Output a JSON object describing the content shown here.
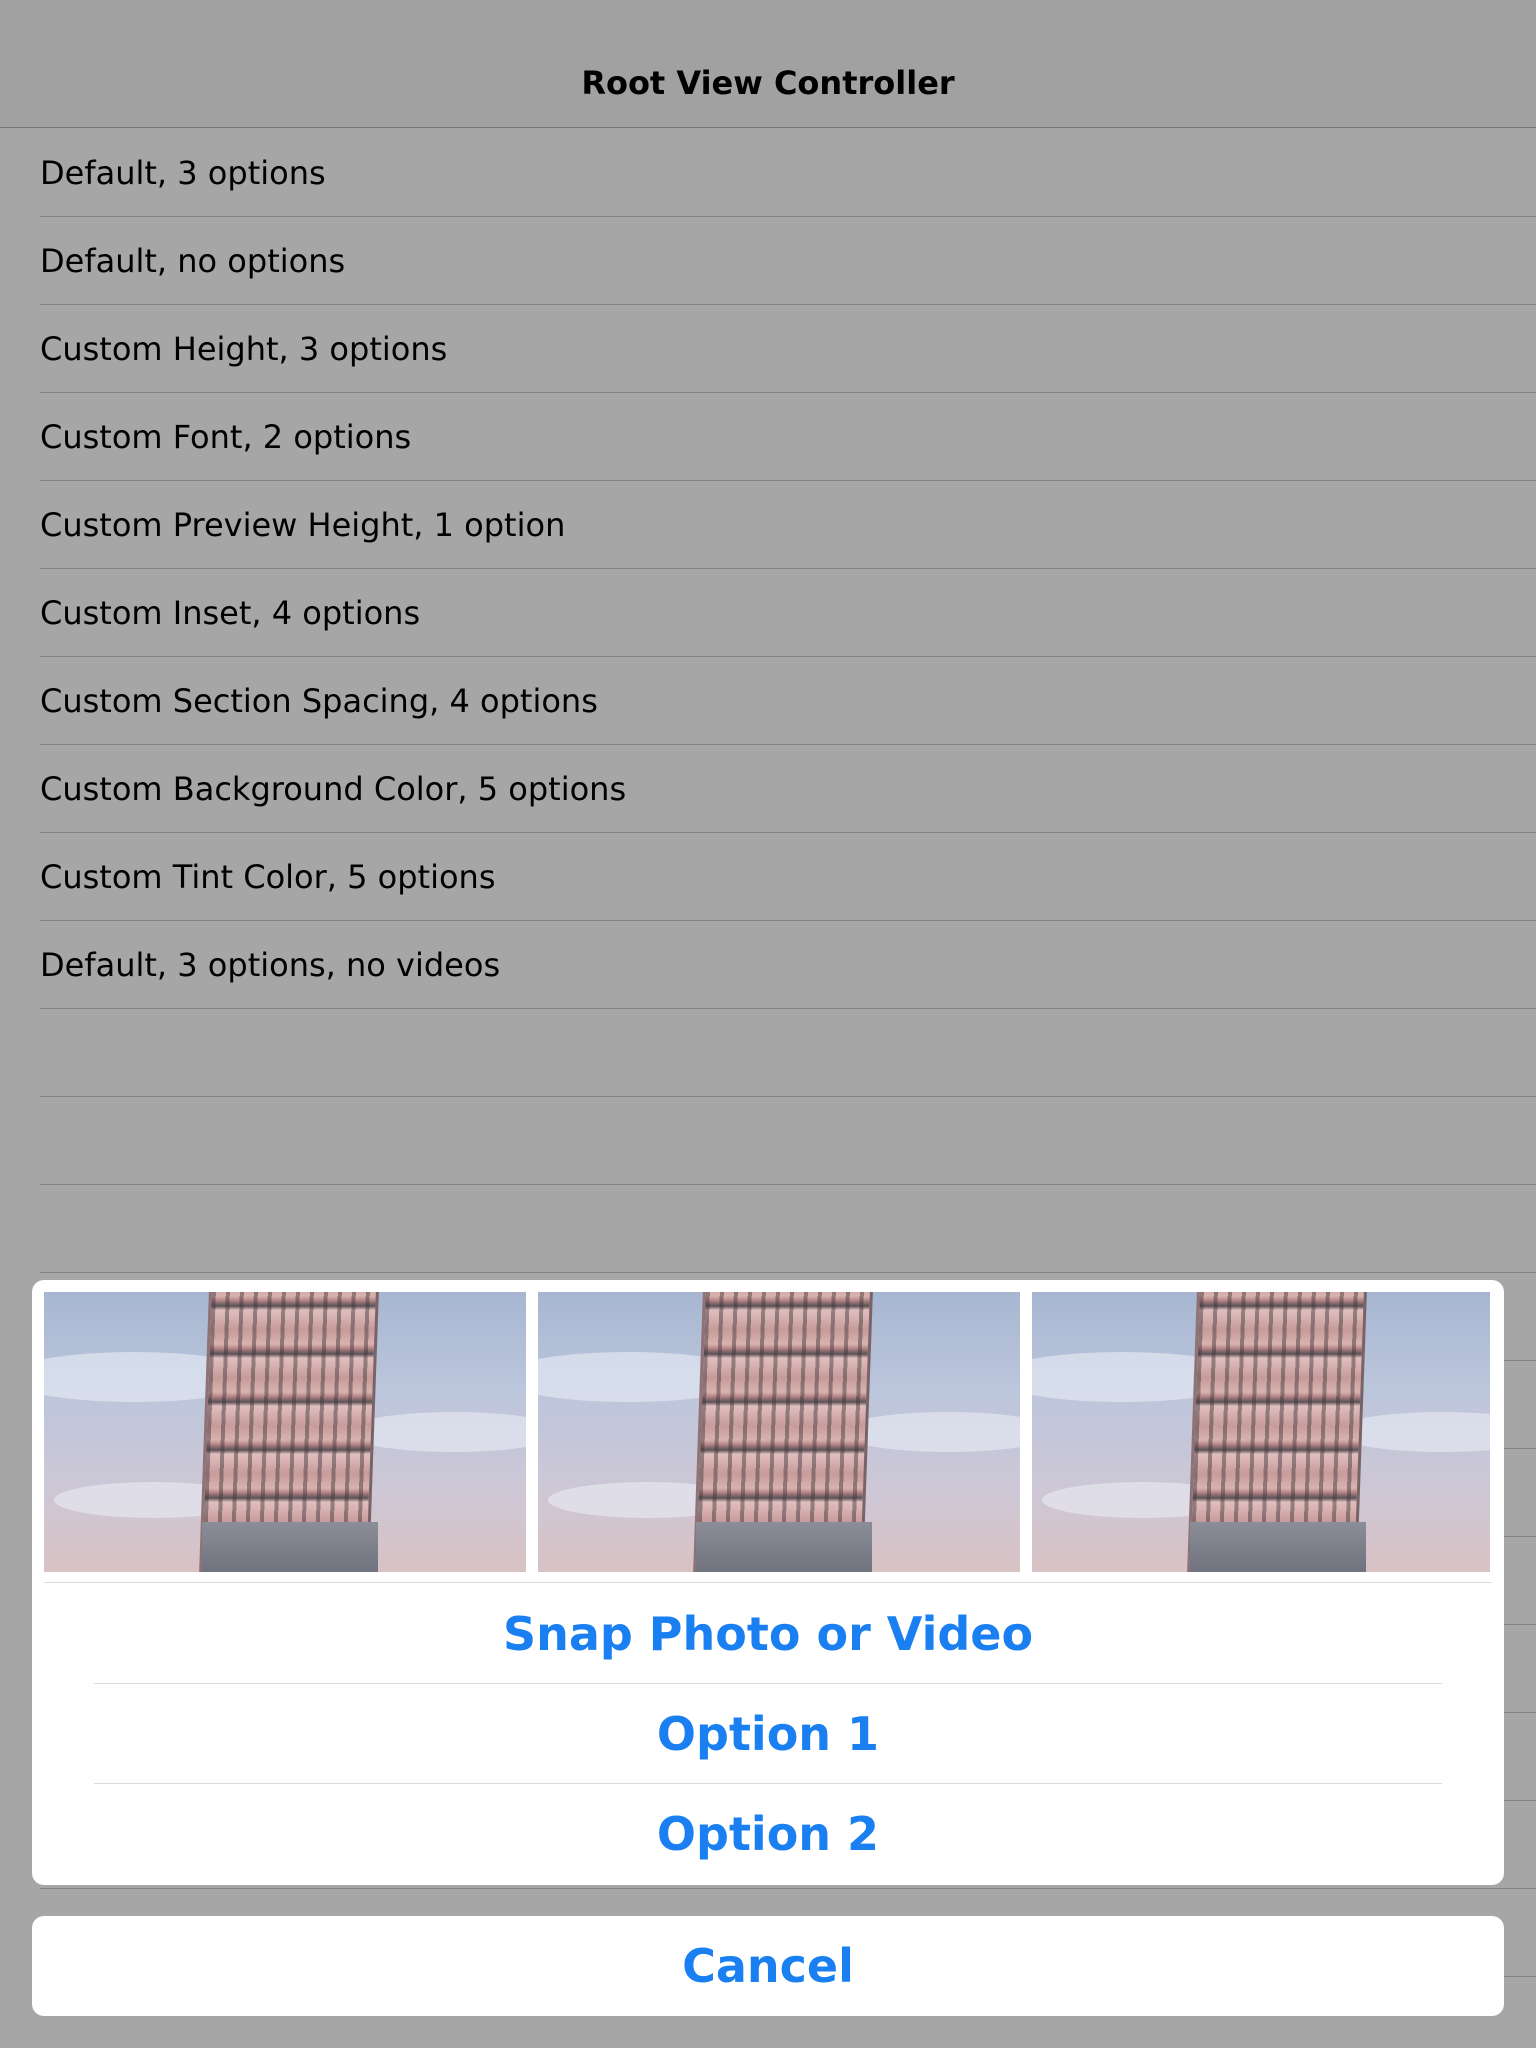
{
  "navbar": {
    "title": "Root View Controller"
  },
  "table": {
    "rows": [
      "Default, 3 options",
      "Default, no options",
      "Custom Height, 3 options",
      "Custom Font, 2 options",
      "Custom Preview Height, 1 option",
      "Custom Inset, 4 options",
      "Custom Section Spacing, 4 options",
      "Custom Background Color, 5 options",
      "Custom Tint Color, 5 options",
      "Default, 3 options, no videos",
      "",
      "",
      "",
      "",
      "",
      "",
      "",
      "",
      "",
      "",
      "",
      ""
    ]
  },
  "action_sheet": {
    "preview_photos": [
      "leaning-tower-photo",
      "leaning-tower-photo",
      "leaning-tower-photo"
    ],
    "options": [
      "Snap Photo or Video",
      "Option 1",
      "Option 2"
    ],
    "cancel": "Cancel",
    "tint_color": "#1a7ff0"
  }
}
